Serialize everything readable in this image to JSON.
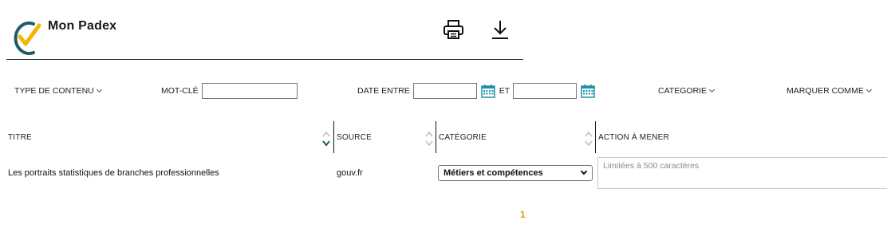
{
  "header": {
    "app_title": "Mon Padex",
    "icons": {
      "logo": "check-logo",
      "print": "printer-icon",
      "download": "download-icon"
    },
    "colors": {
      "logo_check": "#f2b705",
      "logo_ring": "#1f5c63"
    }
  },
  "filters": {
    "content_type_label": "TYPE DE CONTENU",
    "keyword_label": "MOT-CLÉ",
    "keyword_value": "",
    "date_between_label": "DATE ENTRE",
    "date_from_value": "",
    "and_label": "ET",
    "date_to_value": "",
    "category_label": "CATEGORIE",
    "mark_as_label": "MARQUER COMME"
  },
  "table": {
    "columns": [
      "TITRE",
      "SOURCE",
      "CATÉGORIE",
      "ACTION À MENER"
    ],
    "rows": [
      {
        "title": "Les portraits statistiques de branches professionnelles",
        "source": "gouv.fr",
        "category": "Métiers et compétences",
        "action_placeholder": "Limitées à 500 caractères"
      }
    ]
  },
  "pagination": {
    "current_page": "1",
    "accent_color": "#d9a400"
  }
}
